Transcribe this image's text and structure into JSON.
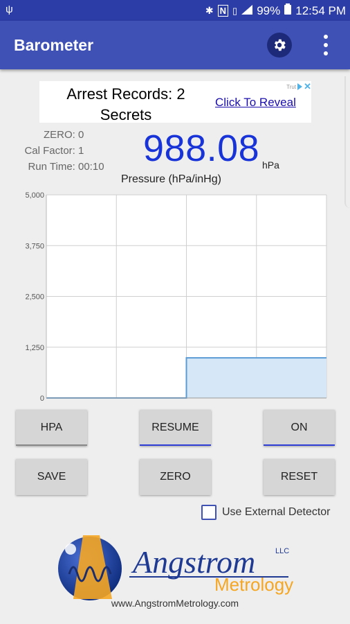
{
  "statusbar": {
    "usb_icon": "usb-icon",
    "battery": "99%",
    "time": "12:54 PM",
    "icons": [
      "bluetooth-icon",
      "nfc-icon",
      "vibrate-icon",
      "signal-icon",
      "battery-icon"
    ]
  },
  "appbar": {
    "title": "Barometer",
    "settings_icon": "gear-icon",
    "menu_icon": "overflow-menu-icon"
  },
  "ad": {
    "headline": "Arrest Records: 2 Secrets",
    "cta": "Click To Reveal",
    "badge": "Trut"
  },
  "info": {
    "zero_label": "ZERO:",
    "zero_value": "0",
    "cal_label": "Cal Factor:",
    "cal_value": "1",
    "run_label": "Run Time:",
    "run_value": "00:10"
  },
  "reading": {
    "value": "988.08",
    "unit": "hPa"
  },
  "chart_data": {
    "type": "area",
    "title": "Pressure (hPa/inHg)",
    "xlabel": "",
    "ylabel": "",
    "ylim": [
      0,
      5000
    ],
    "yticks": [
      "5,000",
      "3,750",
      "2,500",
      "1,250",
      "0"
    ],
    "grid": true,
    "series": [
      {
        "x": [
          0,
          1,
          2,
          3,
          4,
          5,
          6,
          7,
          8,
          9,
          10
        ],
        "values": [
          0,
          0,
          0,
          0,
          0,
          988.08,
          988.08,
          988.08,
          988.08,
          988.08,
          988.08
        ],
        "color": "#5b9bd5",
        "fill": "#d6e8f7"
      }
    ],
    "xlim": [
      0,
      10
    ]
  },
  "buttons": {
    "hpa": "HPA",
    "resume": "RESUME",
    "on": "ON",
    "save": "SAVE",
    "zero": "ZERO",
    "reset": "RESET"
  },
  "accent": "#2d3dd6",
  "external": {
    "label": "Use External Detector",
    "checked": false
  },
  "logo": {
    "name": "Angstrom",
    "sub": "Metrology",
    "llc": "LLC"
  },
  "url": "www.AngstromMetrology.com"
}
